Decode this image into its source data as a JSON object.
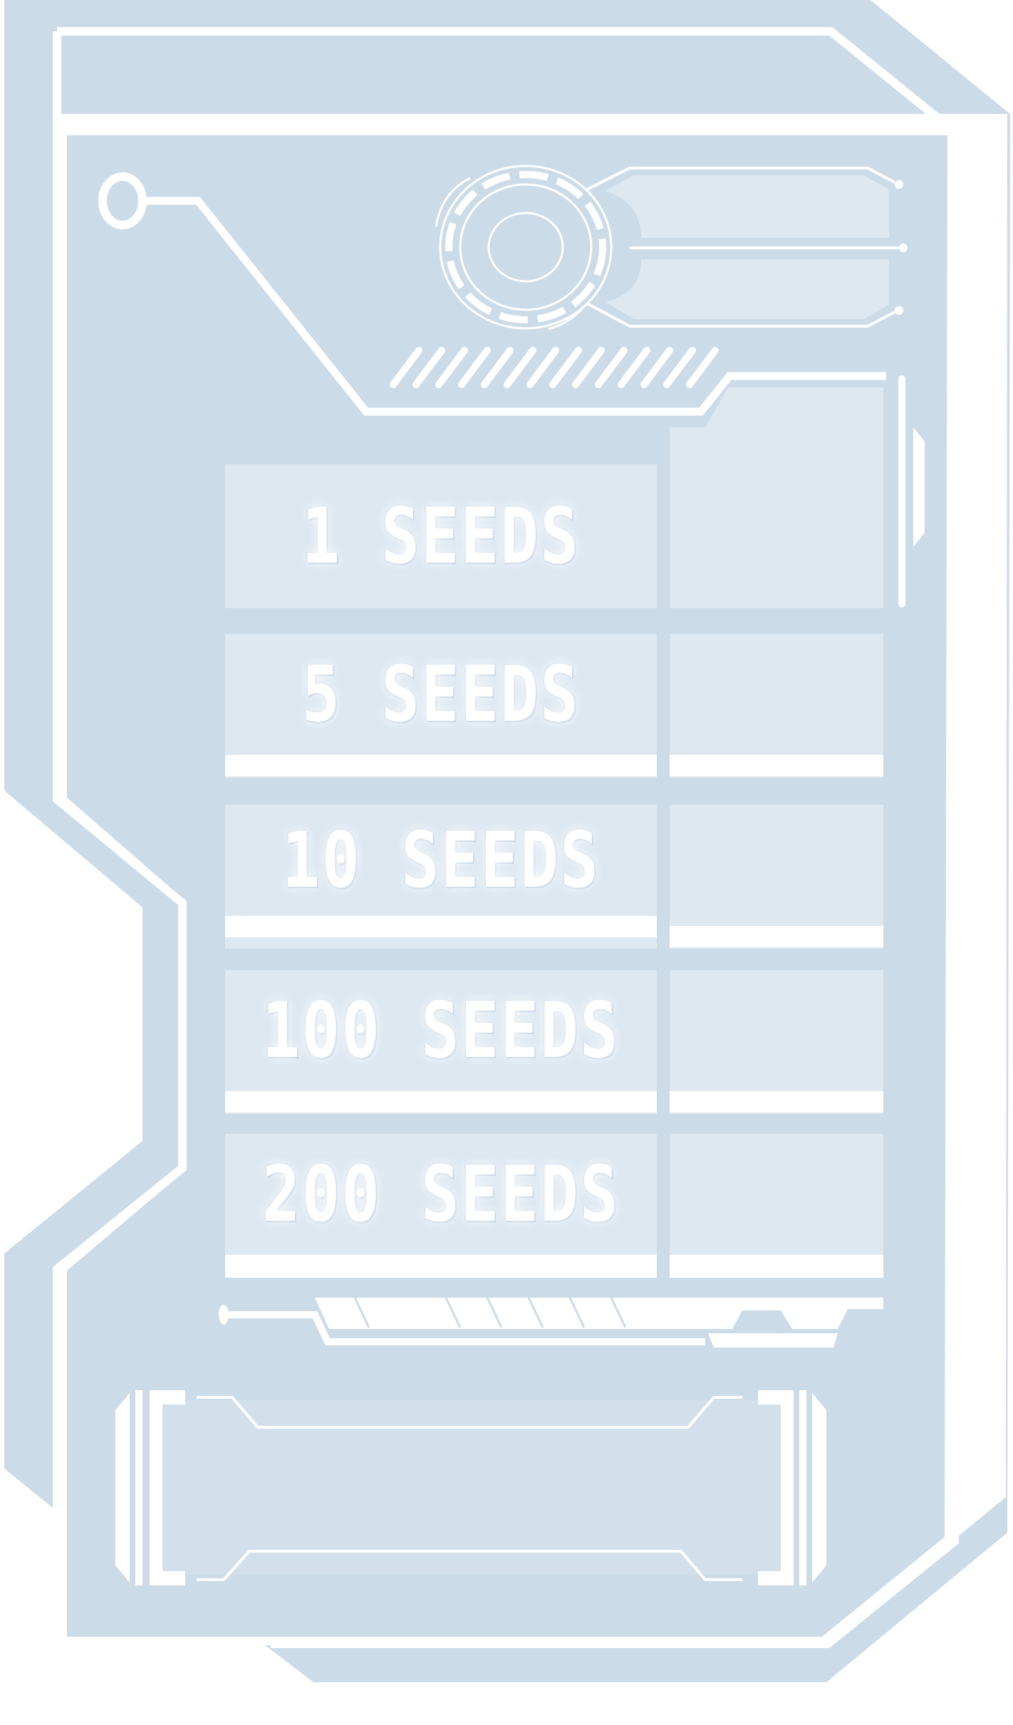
{
  "theme": {
    "frame_color": "#ccdbe8",
    "panel_color": "#dee8f1",
    "inner_color": "#d3e0ec",
    "accent_color": "#ffffff"
  },
  "seed_options": [
    {
      "label": "1 SEEDS",
      "amount": 1
    },
    {
      "label": "5 SEEDS",
      "amount": 5
    },
    {
      "label": "10 SEEDS",
      "amount": 10
    },
    {
      "label": "100 SEEDS",
      "amount": 100
    },
    {
      "label": "200 SEEDS",
      "amount": 200
    }
  ],
  "icons": {
    "header": "target-reticle-icon",
    "stripes": "hazard-stripes-icon",
    "slider": "progress-track-icon"
  }
}
